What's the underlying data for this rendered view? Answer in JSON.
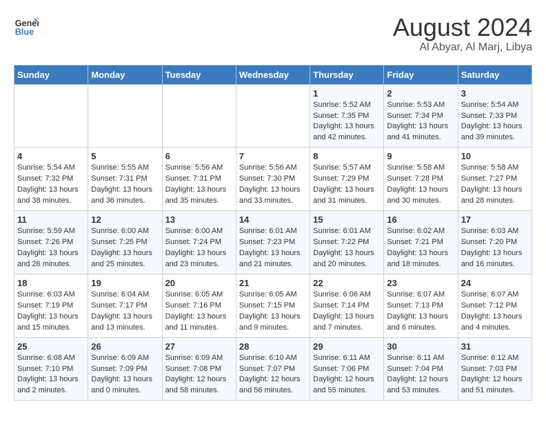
{
  "header": {
    "logo_line1": "General",
    "logo_line2": "Blue",
    "month_year": "August 2024",
    "location": "Al Abyar, Al Marj, Libya"
  },
  "weekdays": [
    "Sunday",
    "Monday",
    "Tuesday",
    "Wednesday",
    "Thursday",
    "Friday",
    "Saturday"
  ],
  "weeks": [
    [
      {
        "day": "",
        "content": ""
      },
      {
        "day": "",
        "content": ""
      },
      {
        "day": "",
        "content": ""
      },
      {
        "day": "",
        "content": ""
      },
      {
        "day": "1",
        "content": "Sunrise: 5:52 AM\nSunset: 7:35 PM\nDaylight: 13 hours\nand 42 minutes."
      },
      {
        "day": "2",
        "content": "Sunrise: 5:53 AM\nSunset: 7:34 PM\nDaylight: 13 hours\nand 41 minutes."
      },
      {
        "day": "3",
        "content": "Sunrise: 5:54 AM\nSunset: 7:33 PM\nDaylight: 13 hours\nand 39 minutes."
      }
    ],
    [
      {
        "day": "4",
        "content": "Sunrise: 5:54 AM\nSunset: 7:32 PM\nDaylight: 13 hours\nand 38 minutes."
      },
      {
        "day": "5",
        "content": "Sunrise: 5:55 AM\nSunset: 7:31 PM\nDaylight: 13 hours\nand 36 minutes."
      },
      {
        "day": "6",
        "content": "Sunrise: 5:56 AM\nSunset: 7:31 PM\nDaylight: 13 hours\nand 35 minutes."
      },
      {
        "day": "7",
        "content": "Sunrise: 5:56 AM\nSunset: 7:30 PM\nDaylight: 13 hours\nand 33 minutes."
      },
      {
        "day": "8",
        "content": "Sunrise: 5:57 AM\nSunset: 7:29 PM\nDaylight: 13 hours\nand 31 minutes."
      },
      {
        "day": "9",
        "content": "Sunrise: 5:58 AM\nSunset: 7:28 PM\nDaylight: 13 hours\nand 30 minutes."
      },
      {
        "day": "10",
        "content": "Sunrise: 5:58 AM\nSunset: 7:27 PM\nDaylight: 13 hours\nand 28 minutes."
      }
    ],
    [
      {
        "day": "11",
        "content": "Sunrise: 5:59 AM\nSunset: 7:26 PM\nDaylight: 13 hours\nand 26 minutes."
      },
      {
        "day": "12",
        "content": "Sunrise: 6:00 AM\nSunset: 7:25 PM\nDaylight: 13 hours\nand 25 minutes."
      },
      {
        "day": "13",
        "content": "Sunrise: 6:00 AM\nSunset: 7:24 PM\nDaylight: 13 hours\nand 23 minutes."
      },
      {
        "day": "14",
        "content": "Sunrise: 6:01 AM\nSunset: 7:23 PM\nDaylight: 13 hours\nand 21 minutes."
      },
      {
        "day": "15",
        "content": "Sunrise: 6:01 AM\nSunset: 7:22 PM\nDaylight: 13 hours\nand 20 minutes."
      },
      {
        "day": "16",
        "content": "Sunrise: 6:02 AM\nSunset: 7:21 PM\nDaylight: 13 hours\nand 18 minutes."
      },
      {
        "day": "17",
        "content": "Sunrise: 6:03 AM\nSunset: 7:20 PM\nDaylight: 13 hours\nand 16 minutes."
      }
    ],
    [
      {
        "day": "18",
        "content": "Sunrise: 6:03 AM\nSunset: 7:19 PM\nDaylight: 13 hours\nand 15 minutes."
      },
      {
        "day": "19",
        "content": "Sunrise: 6:04 AM\nSunset: 7:17 PM\nDaylight: 13 hours\nand 13 minutes."
      },
      {
        "day": "20",
        "content": "Sunrise: 6:05 AM\nSunset: 7:16 PM\nDaylight: 13 hours\nand 11 minutes."
      },
      {
        "day": "21",
        "content": "Sunrise: 6:05 AM\nSunset: 7:15 PM\nDaylight: 13 hours\nand 9 minutes."
      },
      {
        "day": "22",
        "content": "Sunrise: 6:06 AM\nSunset: 7:14 PM\nDaylight: 13 hours\nand 7 minutes."
      },
      {
        "day": "23",
        "content": "Sunrise: 6:07 AM\nSunset: 7:13 PM\nDaylight: 13 hours\nand 6 minutes."
      },
      {
        "day": "24",
        "content": "Sunrise: 6:07 AM\nSunset: 7:12 PM\nDaylight: 13 hours\nand 4 minutes."
      }
    ],
    [
      {
        "day": "25",
        "content": "Sunrise: 6:08 AM\nSunset: 7:10 PM\nDaylight: 13 hours\nand 2 minutes."
      },
      {
        "day": "26",
        "content": "Sunrise: 6:09 AM\nSunset: 7:09 PM\nDaylight: 13 hours\nand 0 minutes."
      },
      {
        "day": "27",
        "content": "Sunrise: 6:09 AM\nSunset: 7:08 PM\nDaylight: 12 hours\nand 58 minutes."
      },
      {
        "day": "28",
        "content": "Sunrise: 6:10 AM\nSunset: 7:07 PM\nDaylight: 12 hours\nand 56 minutes."
      },
      {
        "day": "29",
        "content": "Sunrise: 6:11 AM\nSunset: 7:06 PM\nDaylight: 12 hours\nand 55 minutes."
      },
      {
        "day": "30",
        "content": "Sunrise: 6:11 AM\nSunset: 7:04 PM\nDaylight: 12 hours\nand 53 minutes."
      },
      {
        "day": "31",
        "content": "Sunrise: 6:12 AM\nSunset: 7:03 PM\nDaylight: 12 hours\nand 51 minutes."
      }
    ]
  ]
}
